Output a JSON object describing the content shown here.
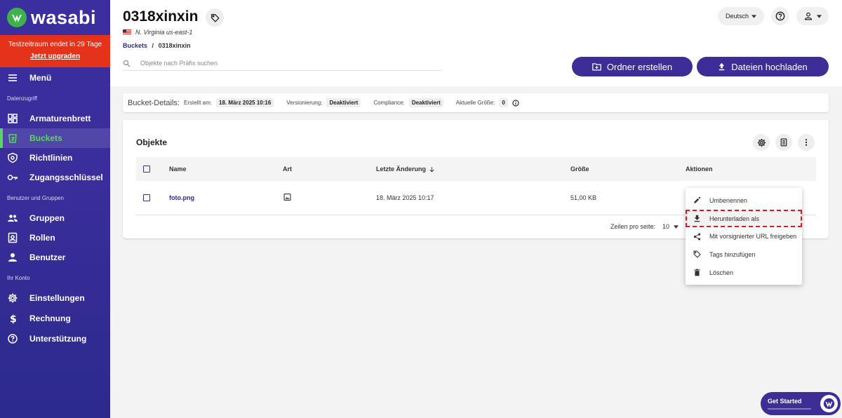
{
  "brand": {
    "name": "wasabi"
  },
  "trial": {
    "text": "Testzeitraum endet in 29 Tage",
    "upgrade": "Jetzt upgraden"
  },
  "sidebar": {
    "menu_label": "Menü",
    "sections": [
      {
        "label": "Datenzugriff",
        "items": [
          {
            "label": "Armaturenbrett",
            "icon": "dashboard-icon"
          },
          {
            "label": "Buckets",
            "icon": "bucket-icon",
            "active": true
          },
          {
            "label": "Richtlinien",
            "icon": "shield-icon"
          },
          {
            "label": "Zugangsschlüssel",
            "icon": "key-icon"
          }
        ]
      },
      {
        "label": "Benutzer und Gruppen",
        "items": [
          {
            "label": "Gruppen",
            "icon": "group-icon"
          },
          {
            "label": "Rollen",
            "icon": "badge-icon"
          },
          {
            "label": "Benutzer",
            "icon": "person-icon"
          }
        ]
      },
      {
        "label": "Ihr Konto",
        "items": [
          {
            "label": "Einstellungen",
            "icon": "gear-icon"
          },
          {
            "label": "Rechnung",
            "icon": "dollar-icon"
          },
          {
            "label": "Unterstützung",
            "icon": "help-icon"
          }
        ]
      }
    ]
  },
  "header": {
    "bucket_name": "0318xinxin",
    "region": "N. Virginia us-east-1",
    "breadcrumb_root": "Buckets",
    "breadcrumb_sep": "/",
    "breadcrumb_current": "0318xinxin",
    "search_placeholder": "Objekte nach Präfix suchen",
    "create_folder": "Ordner erstellen",
    "upload_files": "Dateien hochladen",
    "language": "Deutsch"
  },
  "details": {
    "title": "Bucket-Details:",
    "created_label": "Erstellt am:",
    "created_value": "18. März 2025 10:16",
    "versioning_label": "Versionierung:",
    "versioning_value": "Deaktiviert",
    "compliance_label": "Compliance:",
    "compliance_value": "Deaktiviert",
    "size_label": "Aktuelle Größe:",
    "size_value": "0"
  },
  "objects": {
    "title": "Objekte",
    "columns": {
      "name": "Name",
      "type": "Art",
      "modified": "Letzte Änderung",
      "size": "Größe",
      "actions": "Aktionen"
    },
    "rows": [
      {
        "name": "foto.png",
        "type_icon": "image-icon",
        "modified": "18. März 2025 10:17",
        "size": "51,00 KB"
      }
    ],
    "rows_per_page_label": "Zeilen pro seite:",
    "rows_per_page_value": "10"
  },
  "context_menu": {
    "items": [
      {
        "label": "Umbenennen",
        "icon": "pencil-icon"
      },
      {
        "label": "Herunterladen als",
        "icon": "download-icon",
        "highlighted": true
      },
      {
        "label": "Mit vorsignierter URL freigeben",
        "icon": "share-icon"
      },
      {
        "label": "Tags hinzufügen",
        "icon": "tag-icon"
      },
      {
        "label": "Löschen",
        "icon": "trash-icon"
      }
    ]
  },
  "get_started": {
    "label": "Get Started"
  },
  "colors": {
    "primary": "#3c2e96",
    "active_green": "#5cd663",
    "trial_red": "#e5331b",
    "highlight_red": "#e0151d"
  }
}
